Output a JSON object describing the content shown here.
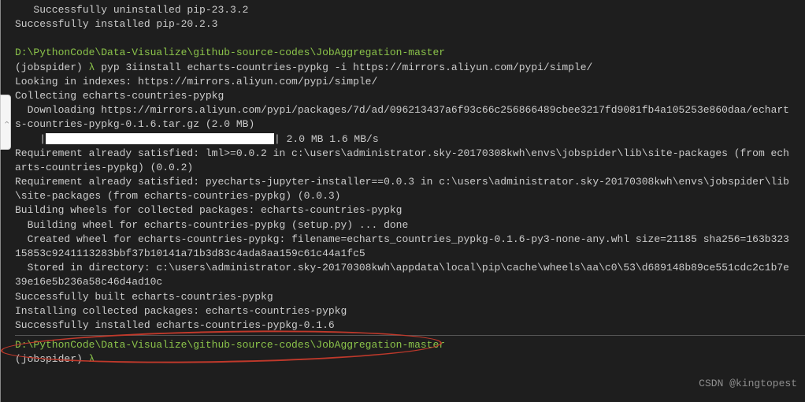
{
  "lines": {
    "l0": "   Successfully uninstalled pip-23.3.2",
    "l1": "Successfully installed pip-20.2.3",
    "l2": "",
    "l3_path": "D:\\PythonCode\\Data-Visualize\\github-source-codes\\JobAggregation-master",
    "l4_env": "(jobspider)",
    "l4_lambda": " λ ",
    "l4_cmd": "pyp 3iinstall echarts-countries-pypkg -i https://mirrors.aliyun.com/pypi/simple/",
    "l5": "Looking in indexes: https://mirrors.aliyun.com/pypi/simple/",
    "l6": "Collecting echarts-countries-pypkg",
    "l7": "  Downloading https://mirrors.aliyun.com/pypi/packages/7d/ad/096213437a6f93c66c256866489cbee3217fd9081fb4a105253e860daa/echarts-countries-pypkg-0.1.6.tar.gz (2.0 MB)",
    "l8_prefix": "    |",
    "l8_suffix": "| 2.0 MB 1.6 MB/s",
    "l9": "Requirement already satisfied: lml>=0.0.2 in c:\\users\\administrator.sky-20170308kwh\\envs\\jobspider\\lib\\site-packages (from echarts-countries-pypkg) (0.0.2)",
    "l10": "Requirement already satisfied: pyecharts-jupyter-installer==0.0.3 in c:\\users\\administrator.sky-20170308kwh\\envs\\jobspider\\lib\\site-packages (from echarts-countries-pypkg) (0.0.3)",
    "l11": "Building wheels for collected packages: echarts-countries-pypkg",
    "l12": "  Building wheel for echarts-countries-pypkg (setup.py) ... done",
    "l13": "  Created wheel for echarts-countries-pypkg: filename=echarts_countries_pypkg-0.1.6-py3-none-any.whl size=21185 sha256=163b32315853c9241113283bbf37b10141a71b3d83c4ada8aa159c61c44a1fc5",
    "l14": "  Stored in directory: c:\\users\\administrator.sky-20170308kwh\\appdata\\local\\pip\\cache\\wheels\\aa\\c0\\53\\d689148b89ce551cdc2c1b7e39e16e5b236a58c46d4ad10c",
    "l15": "Successfully built echarts-countries-pypkg",
    "l16": "Installing collected packages: echarts-countries-pypkg",
    "l17": "Successfully installed echarts-countries-pypkg-0.1.6",
    "l18": "",
    "l19_path": "D:\\PythonCode\\Data-Visualize\\github-source-codes\\JobAggregation-master",
    "l20_env": "(jobspider)",
    "l20_lambda": " λ"
  },
  "watermark": "CSDN @kingtopest"
}
